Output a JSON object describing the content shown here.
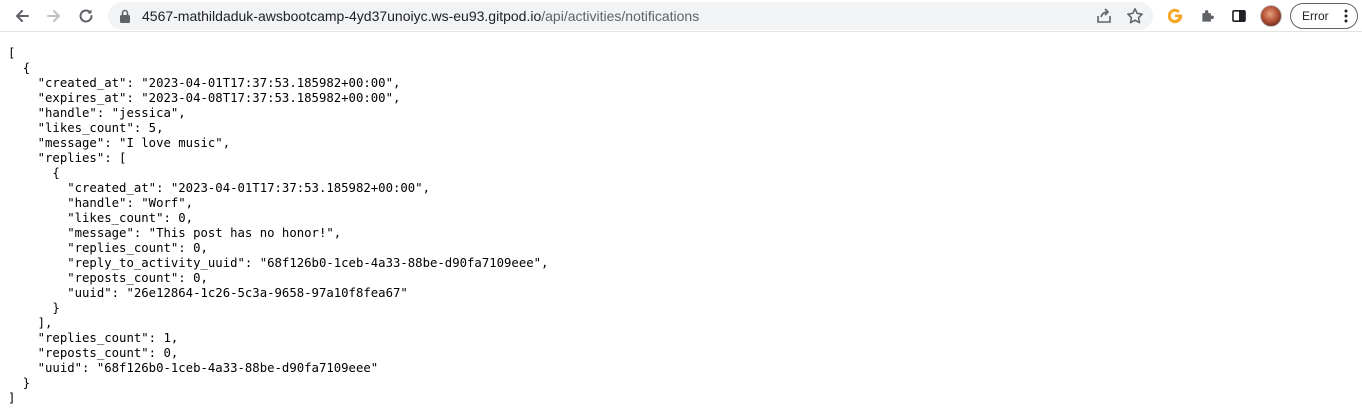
{
  "browser": {
    "url_host": "4567-mathildaduk-awsbootcamp-4yd37unoiyc.ws-eu93.gitpod.io",
    "url_path": "/api/activities/notifications",
    "profile_button_label": "Error",
    "icons": {
      "back": "arrow-left-icon",
      "forward": "arrow-right-icon",
      "reload": "reload-icon",
      "lock": "lock-icon",
      "share": "share-icon",
      "bookmark": "star-icon",
      "grammarly": "grammarly-icon",
      "extensions": "puzzle-icon",
      "side_panel": "side-panel-icon",
      "menu": "kebab-menu-icon"
    },
    "colors": {
      "grammarly": "#f5a623",
      "toolbar_bg": "#ffffff",
      "omnibox_bg": "#f1f3f4"
    }
  },
  "json_lines": [
    "[",
    "  {",
    "    \"created_at\": \"2023-04-01T17:37:53.185982+00:00\",",
    "    \"expires_at\": \"2023-04-08T17:37:53.185982+00:00\",",
    "    \"handle\": \"jessica\",",
    "    \"likes_count\": 5,",
    "    \"message\": \"I love music\",",
    "    \"replies\": [",
    "      {",
    "        \"created_at\": \"2023-04-01T17:37:53.185982+00:00\",",
    "        \"handle\": \"Worf\",",
    "        \"likes_count\": 0,",
    "        \"message\": \"This post has no honor!\",",
    "        \"replies_count\": 0,",
    "        \"reply_to_activity_uuid\": \"68f126b0-1ceb-4a33-88be-d90fa7109eee\",",
    "        \"reposts_count\": 0,",
    "        \"uuid\": \"26e12864-1c26-5c3a-9658-97a10f8fea67\"",
    "      }",
    "    ],",
    "    \"replies_count\": 1,",
    "    \"reposts_count\": 0,",
    "    \"uuid\": \"68f126b0-1ceb-4a33-88be-d90fa7109eee\"",
    "  }",
    "]"
  ]
}
